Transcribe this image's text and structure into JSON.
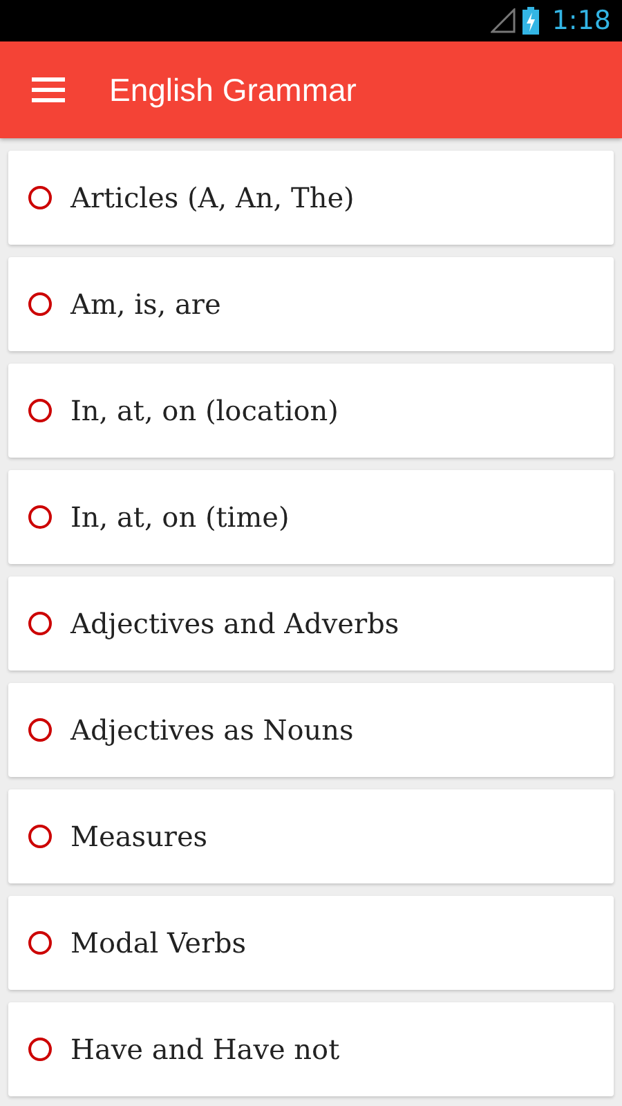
{
  "status_bar": {
    "time": "1:18"
  },
  "toolbar": {
    "title": "English Grammar"
  },
  "topics": [
    {
      "label": "Articles (A, An, The)"
    },
    {
      "label": "Am, is, are"
    },
    {
      "label": "In, at, on (location)"
    },
    {
      "label": "In, at, on (time)"
    },
    {
      "label": "Adjectives and Adverbs"
    },
    {
      "label": "Adjectives as Nouns"
    },
    {
      "label": "Measures"
    },
    {
      "label": "Modal Verbs"
    },
    {
      "label": "Have and Have not"
    }
  ]
}
